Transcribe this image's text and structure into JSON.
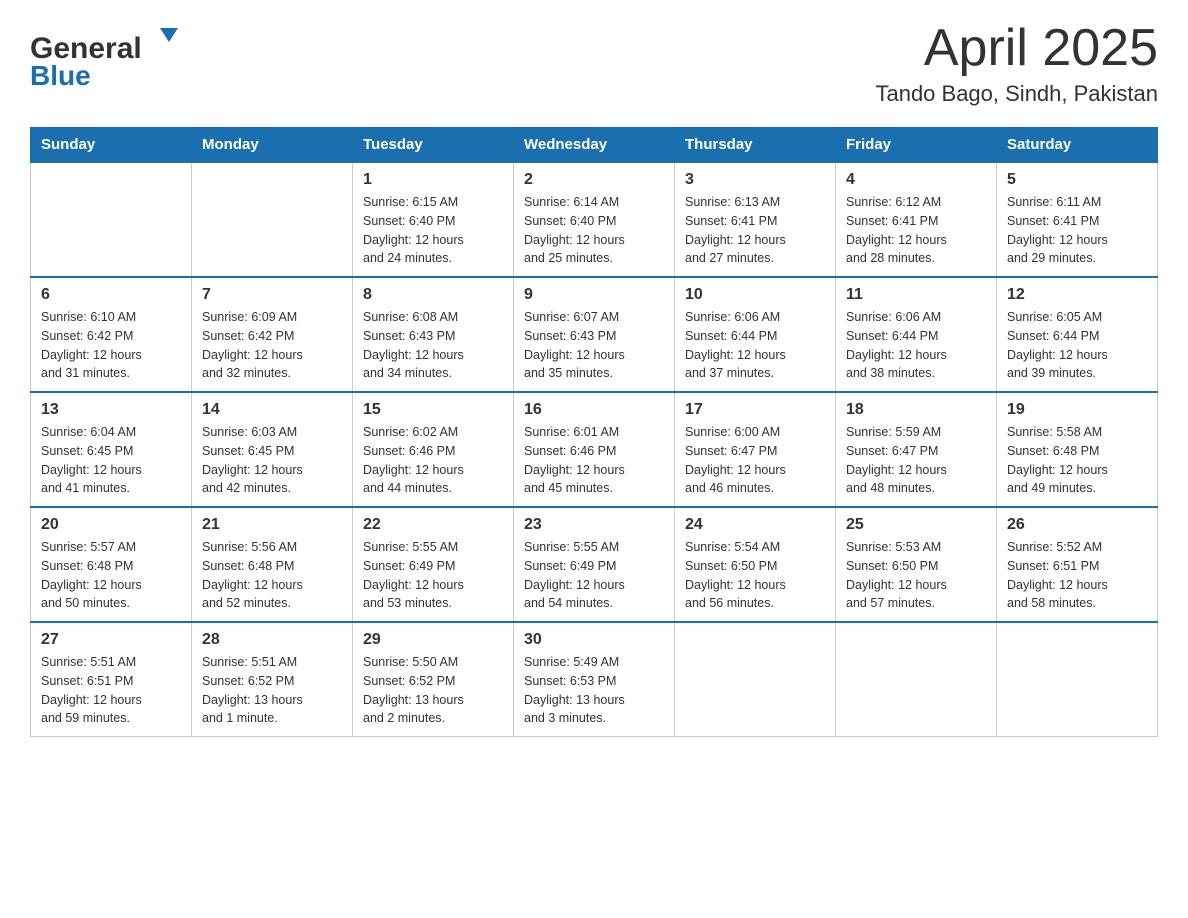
{
  "header": {
    "logo_line1": "General",
    "logo_line2": "Blue",
    "month": "April 2025",
    "location": "Tando Bago, Sindh, Pakistan"
  },
  "weekdays": [
    "Sunday",
    "Monday",
    "Tuesday",
    "Wednesday",
    "Thursday",
    "Friday",
    "Saturday"
  ],
  "weeks": [
    [
      {
        "day": "",
        "info": ""
      },
      {
        "day": "",
        "info": ""
      },
      {
        "day": "1",
        "info": "Sunrise: 6:15 AM\nSunset: 6:40 PM\nDaylight: 12 hours\nand 24 minutes."
      },
      {
        "day": "2",
        "info": "Sunrise: 6:14 AM\nSunset: 6:40 PM\nDaylight: 12 hours\nand 25 minutes."
      },
      {
        "day": "3",
        "info": "Sunrise: 6:13 AM\nSunset: 6:41 PM\nDaylight: 12 hours\nand 27 minutes."
      },
      {
        "day": "4",
        "info": "Sunrise: 6:12 AM\nSunset: 6:41 PM\nDaylight: 12 hours\nand 28 minutes."
      },
      {
        "day": "5",
        "info": "Sunrise: 6:11 AM\nSunset: 6:41 PM\nDaylight: 12 hours\nand 29 minutes."
      }
    ],
    [
      {
        "day": "6",
        "info": "Sunrise: 6:10 AM\nSunset: 6:42 PM\nDaylight: 12 hours\nand 31 minutes."
      },
      {
        "day": "7",
        "info": "Sunrise: 6:09 AM\nSunset: 6:42 PM\nDaylight: 12 hours\nand 32 minutes."
      },
      {
        "day": "8",
        "info": "Sunrise: 6:08 AM\nSunset: 6:43 PM\nDaylight: 12 hours\nand 34 minutes."
      },
      {
        "day": "9",
        "info": "Sunrise: 6:07 AM\nSunset: 6:43 PM\nDaylight: 12 hours\nand 35 minutes."
      },
      {
        "day": "10",
        "info": "Sunrise: 6:06 AM\nSunset: 6:44 PM\nDaylight: 12 hours\nand 37 minutes."
      },
      {
        "day": "11",
        "info": "Sunrise: 6:06 AM\nSunset: 6:44 PM\nDaylight: 12 hours\nand 38 minutes."
      },
      {
        "day": "12",
        "info": "Sunrise: 6:05 AM\nSunset: 6:44 PM\nDaylight: 12 hours\nand 39 minutes."
      }
    ],
    [
      {
        "day": "13",
        "info": "Sunrise: 6:04 AM\nSunset: 6:45 PM\nDaylight: 12 hours\nand 41 minutes."
      },
      {
        "day": "14",
        "info": "Sunrise: 6:03 AM\nSunset: 6:45 PM\nDaylight: 12 hours\nand 42 minutes."
      },
      {
        "day": "15",
        "info": "Sunrise: 6:02 AM\nSunset: 6:46 PM\nDaylight: 12 hours\nand 44 minutes."
      },
      {
        "day": "16",
        "info": "Sunrise: 6:01 AM\nSunset: 6:46 PM\nDaylight: 12 hours\nand 45 minutes."
      },
      {
        "day": "17",
        "info": "Sunrise: 6:00 AM\nSunset: 6:47 PM\nDaylight: 12 hours\nand 46 minutes."
      },
      {
        "day": "18",
        "info": "Sunrise: 5:59 AM\nSunset: 6:47 PM\nDaylight: 12 hours\nand 48 minutes."
      },
      {
        "day": "19",
        "info": "Sunrise: 5:58 AM\nSunset: 6:48 PM\nDaylight: 12 hours\nand 49 minutes."
      }
    ],
    [
      {
        "day": "20",
        "info": "Sunrise: 5:57 AM\nSunset: 6:48 PM\nDaylight: 12 hours\nand 50 minutes."
      },
      {
        "day": "21",
        "info": "Sunrise: 5:56 AM\nSunset: 6:48 PM\nDaylight: 12 hours\nand 52 minutes."
      },
      {
        "day": "22",
        "info": "Sunrise: 5:55 AM\nSunset: 6:49 PM\nDaylight: 12 hours\nand 53 minutes."
      },
      {
        "day": "23",
        "info": "Sunrise: 5:55 AM\nSunset: 6:49 PM\nDaylight: 12 hours\nand 54 minutes."
      },
      {
        "day": "24",
        "info": "Sunrise: 5:54 AM\nSunset: 6:50 PM\nDaylight: 12 hours\nand 56 minutes."
      },
      {
        "day": "25",
        "info": "Sunrise: 5:53 AM\nSunset: 6:50 PM\nDaylight: 12 hours\nand 57 minutes."
      },
      {
        "day": "26",
        "info": "Sunrise: 5:52 AM\nSunset: 6:51 PM\nDaylight: 12 hours\nand 58 minutes."
      }
    ],
    [
      {
        "day": "27",
        "info": "Sunrise: 5:51 AM\nSunset: 6:51 PM\nDaylight: 12 hours\nand 59 minutes."
      },
      {
        "day": "28",
        "info": "Sunrise: 5:51 AM\nSunset: 6:52 PM\nDaylight: 13 hours\nand 1 minute."
      },
      {
        "day": "29",
        "info": "Sunrise: 5:50 AM\nSunset: 6:52 PM\nDaylight: 13 hours\nand 2 minutes."
      },
      {
        "day": "30",
        "info": "Sunrise: 5:49 AM\nSunset: 6:53 PM\nDaylight: 13 hours\nand 3 minutes."
      },
      {
        "day": "",
        "info": ""
      },
      {
        "day": "",
        "info": ""
      },
      {
        "day": "",
        "info": ""
      }
    ]
  ]
}
